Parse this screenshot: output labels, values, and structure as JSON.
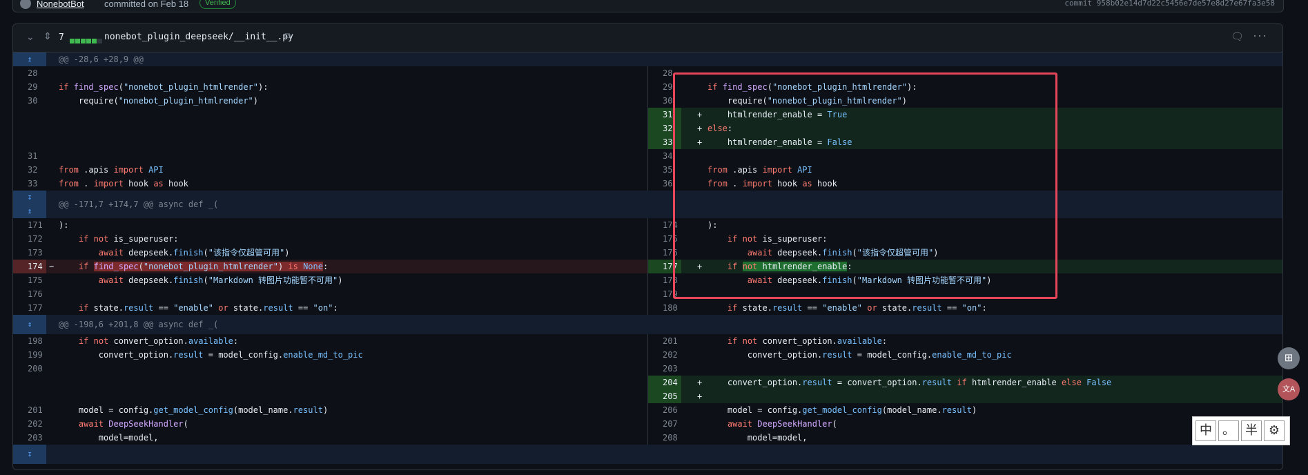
{
  "commit_bar": {
    "author": "NonebotBot",
    "message": "committed on Feb 18",
    "verified": "Verified",
    "commit_label": "commit 958b02e14d7d22c5456e7de57e8d27e67fa3e58"
  },
  "file": {
    "changes": "7",
    "name": "nonebot_plugin_deepseek/__init__.py",
    "diffstat_icons": [
      "added",
      "added",
      "added",
      "added",
      "added",
      "unchanged"
    ]
  },
  "diff": {
    "hunks": [
      "@@ -28,6 +28,9 @@",
      "@@ -171,7 +174,7 @@ async def _(",
      "@@ -198,6 +201,8 @@ async def _("
    ],
    "left_numbers": [
      "28",
      "29",
      "30",
      "31",
      "32",
      "33",
      "171",
      "172",
      "173",
      "174",
      "175",
      "176",
      "177",
      "198",
      "199",
      "200",
      "201",
      "202",
      "203"
    ],
    "right_numbers": [
      "28",
      "29",
      "30",
      "31",
      "32",
      "33",
      "34",
      "35",
      "36",
      "174",
      "175",
      "176",
      "177",
      "178",
      "179",
      "180",
      "201",
      "202",
      "203",
      "204",
      "205",
      "206",
      "207",
      "208"
    ],
    "markers": {
      "add": "+",
      "del": "−"
    }
  },
  "code": {
    "find_spec_line": "if find_spec(\"nonebot_plugin_htmlrender\"):",
    "require_line": "    require(\"nonebot_plugin_htmlrender\")",
    "enable_true": "    htmlrender_enable = True",
    "else_line": "else:",
    "enable_false": "    htmlrender_enable = False",
    "import_api": "from .apis import API",
    "import_hook": "from . import hook as hook",
    "close_paren": "):",
    "not_superuser": "    if not is_superuser:",
    "finish_super": "        await deepseek.finish(\"该指令仅超管可用\")",
    "old_check": "    if find_spec(\"nonebot_plugin_htmlrender\") is None:",
    "new_check": "    if not htmlrender_enable:",
    "finish_md": "        await deepseek.finish(\"Markdown 转图片功能暂不可用\")",
    "state_line": "    if state.result == \"enable\" or state.result == \"on\":",
    "not_available": "    if not convert_option.available:",
    "convert_assign": "        convert_option.result = model_config.enable_md_to_pic",
    "convert_new": "    convert_option.result = convert_option.result if htmlrender_enable else False",
    "model_line": "    model = config.get_model_config(model_name.result)",
    "handler_line": "    await DeepSeekHandler(",
    "model_kw": "        model=model,"
  },
  "ime": {
    "chinese": "中",
    "punct": "。",
    "width": "半",
    "settings": "⚙"
  },
  "float_buttons": {
    "top_icon": "grid-plus-icon",
    "bottom_icon": "translate-icon",
    "bottom_text": "文A"
  },
  "colors": {
    "add_bg": "#12261e",
    "del_bg": "#25171c",
    "annotation": "#e8465b",
    "hunk_bg": "#131d2e"
  }
}
